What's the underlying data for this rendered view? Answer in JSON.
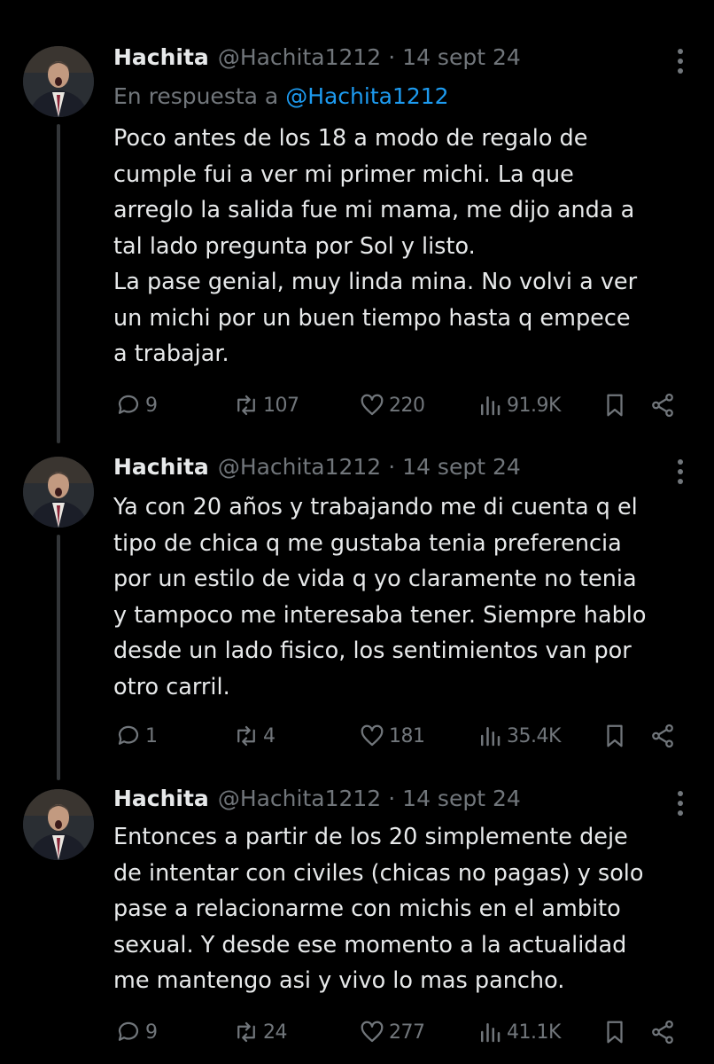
{
  "tweets": [
    {
      "name": "Hachita",
      "handle": "@Hachita1212",
      "date": "14 sept 24",
      "reply_prefix": "En respuesta a",
      "reply_handle": "@Hachita1212",
      "lines": [
        "Poco antes de los 18 a modo de regalo de",
        "cumple fui a ver mi primer michi. La que",
        "arreglo la salida fue mi mama, me dijo anda a",
        "tal lado pregunta por Sol y listo.",
        "La pase genial, muy linda mina. No volvi a ver",
        "un michi por un buen tiempo hasta q empece",
        "a trabajar."
      ],
      "replies": "9",
      "reposts": "107",
      "likes": "220",
      "views": "91.9K"
    },
    {
      "name": "Hachita",
      "handle": "@Hachita1212",
      "date": "14 sept 24",
      "lines": [
        "Ya con 20 años y trabajando me di cuenta q el",
        "tipo de chica q me gustaba tenia preferencia",
        "por un estilo de vida q yo claramente no tenia",
        "y tampoco me interesaba tener. Siempre hablo",
        "desde un lado fisico, los sentimientos van por",
        "otro carril."
      ],
      "replies": "1",
      "reposts": "4",
      "likes": "181",
      "views": "35.4K"
    },
    {
      "name": "Hachita",
      "handle": "@Hachita1212",
      "date": "14 sept 24",
      "lines": [
        "Entonces a partir de los 20 simplemente deje",
        "de intentar con civiles (chicas no pagas) y solo",
        "pase a relacionarme con michis en el ambito",
        "sexual. Y desde ese momento a la actualidad",
        "me mantengo asi y vivo lo mas pancho."
      ],
      "replies": "9",
      "reposts": "24",
      "likes": "277",
      "views": "41.1K"
    }
  ],
  "icons": {
    "reply": "reply-icon",
    "repost": "repost-icon",
    "like": "heart-icon",
    "views": "views-icon",
    "bookmark": "bookmark-icon",
    "share": "share-icon",
    "more": "more-icon"
  },
  "colors": {
    "background": "#000000",
    "text": "#e7e9ea",
    "muted": "#71767b",
    "link": "#1d9bf0",
    "thread_line": "#333639"
  }
}
